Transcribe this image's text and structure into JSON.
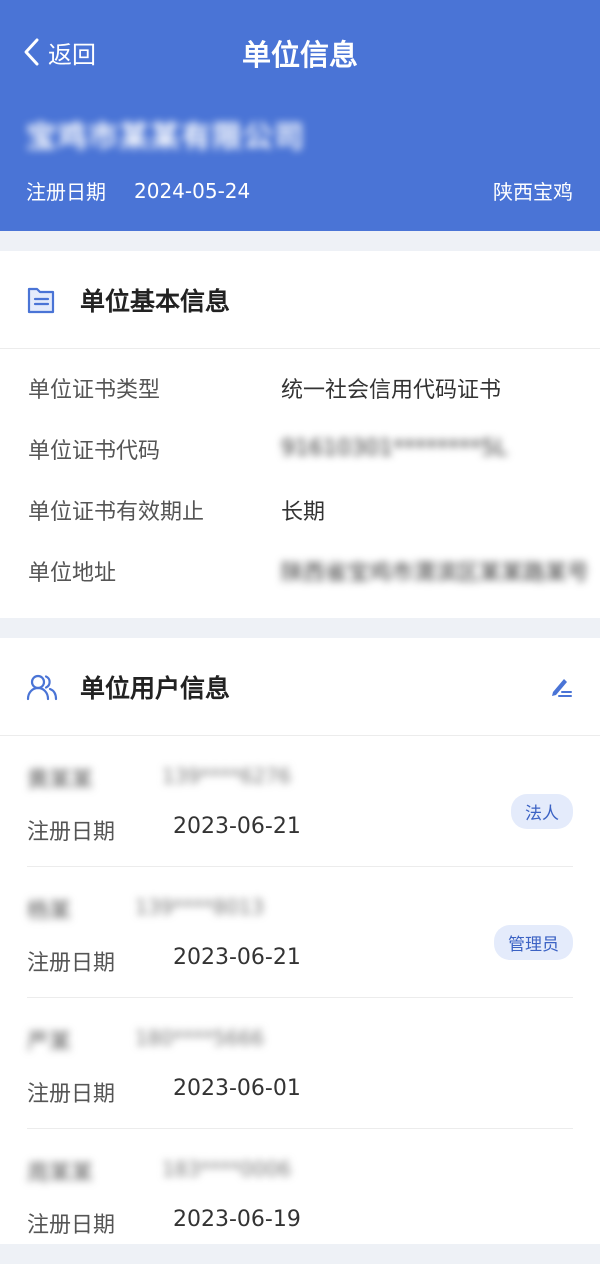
{
  "header": {
    "back_label": "返回",
    "title": "单位信息",
    "company_name": "宝鸡市某某有限公司",
    "reg_label": "注册日期",
    "reg_date": "2024-05-24",
    "location": "陕西宝鸡"
  },
  "basic_info": {
    "title": "单位基本信息",
    "rows": [
      {
        "label": "单位证书类型",
        "value": "统一社会信用代码证书"
      },
      {
        "label": "单位证书代码",
        "value": "91610301********5L"
      },
      {
        "label": "单位证书有效期止",
        "value": "长期"
      },
      {
        "label": "单位地址",
        "value": "陕西省宝鸡市渭滨区某某路某号"
      }
    ]
  },
  "user_info": {
    "title": "单位用户信息",
    "users": [
      {
        "name": "黄某某",
        "phone": "139****6276",
        "date_label": "注册日期",
        "date": "2023-06-21",
        "role": "法人"
      },
      {
        "name": "杨某",
        "phone": "139****8013",
        "date_label": "注册日期",
        "date": "2023-06-21",
        "role": "管理员"
      },
      {
        "name": "严某",
        "phone": "180****5666",
        "date_label": "注册日期",
        "date": "2023-06-01",
        "role": ""
      },
      {
        "name": "周某某",
        "phone": "183****0006",
        "date_label": "注册日期",
        "date": "2023-06-19",
        "role": ""
      }
    ]
  },
  "colors": {
    "primary": "#4a74d6",
    "badge_bg": "#e4ebfb",
    "badge_text": "#3b62c4",
    "page_bg": "#eef1f6"
  },
  "icons": {
    "back": "chevron-left-icon",
    "basic_info": "document-icon",
    "user_info": "users-icon",
    "edit": "edit-pen-icon"
  }
}
